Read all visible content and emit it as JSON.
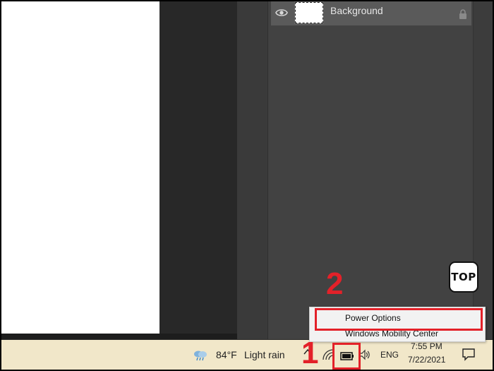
{
  "layers": {
    "items": [
      {
        "name": "Background",
        "visible_icon": "eye-icon",
        "thumb": "white",
        "locked_icon": "lock-icon"
      }
    ]
  },
  "badge": {
    "label": "TOP"
  },
  "annotations": {
    "step1": "1",
    "step2": "2"
  },
  "context_menu": {
    "items": [
      {
        "label": "Power Options"
      },
      {
        "label": "Windows Mobility Center"
      }
    ]
  },
  "taskbar": {
    "weather": {
      "icon": "cloud-rain-icon",
      "temp": "84°F",
      "condition": "Light rain"
    },
    "tray": {
      "chevron_icon": "chevron-up-icon",
      "wifi_icon": "wifi-icon",
      "battery_icon": "battery-icon",
      "volume_icon": "volume-icon",
      "language": "ENG"
    },
    "clock": {
      "time": "7:55 PM",
      "date": "7/22/2021"
    },
    "notification_icon": "notification-icon"
  },
  "colors": {
    "annotation": "#e32129",
    "taskbar_bg": "#f1e7c9",
    "panel_bg": "#424242",
    "canvas_bg": "#ffffff"
  }
}
